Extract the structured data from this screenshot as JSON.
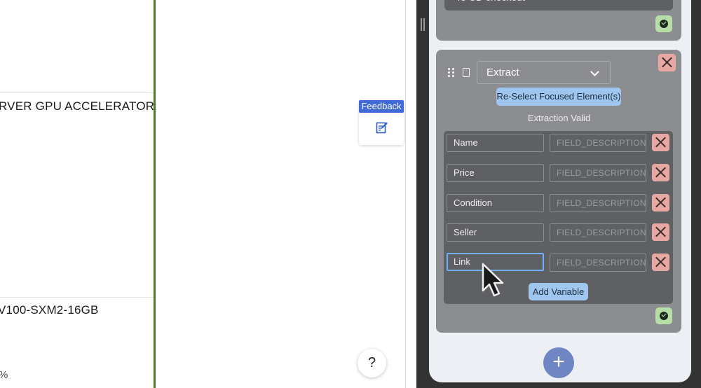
{
  "listing": {
    "item1_title": "RVER GPU ACCELERATOR",
    "item2_title": "V100-SXM2-16GB",
    "item2_pct": "%"
  },
  "feedback": {
    "label": "Feedback",
    "icon": "edit-note-icon"
  },
  "help": {
    "label": "?"
  },
  "panel": {
    "prev_card_field": "To CD checkout",
    "extract_card": {
      "action_select": "Extract",
      "reselect_label": "Re-Select Focused Element(s)",
      "status": "Extraction Valid",
      "fields": [
        {
          "name": "Name",
          "description_placeholder": "FIELD_DESCRIPTION"
        },
        {
          "name": "Price",
          "description_placeholder": "FIELD_DESCRIPTION"
        },
        {
          "name": "Condition",
          "description_placeholder": "FIELD_DESCRIPTION"
        },
        {
          "name": "Seller",
          "description_placeholder": "FIELD_DESCRIPTION"
        },
        {
          "name": "Link",
          "description_placeholder": "FIELD_DESCRIPTION"
        }
      ],
      "add_variable_label": "Add Variable"
    },
    "add_step_label": "+"
  },
  "colors": {
    "accent_green": "#4a7f2e",
    "feedback_blue": "#3f6ad8",
    "pill_blue": "#9fc6ee",
    "fab_blue": "#6f86c5",
    "close_red": "#e7a8a4",
    "ok_green": "#b6dfa7"
  }
}
